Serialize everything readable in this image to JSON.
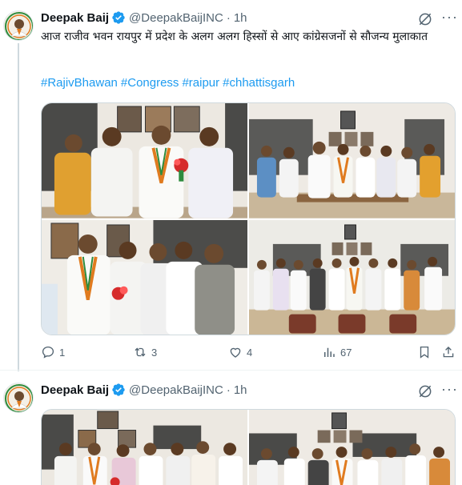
{
  "tweets": [
    {
      "author": {
        "name": "Deepak Baij",
        "handle": "@DeepakBaijINC",
        "time": "1h",
        "avatar_icon": "profile-photo"
      },
      "text": "आज राजीव भवन रायपुर में प्रदेश के अलग अलग हिस्सों से आए कांग्रेसजनों से सौजन्य मुलाकात",
      "hashtags": [
        "#RajivBhawan",
        "#Congress",
        "#raipur",
        "#chhattisgarh"
      ],
      "photos": [
        "group-welcome-bouquet-photo",
        "group-office-meeting-photo",
        "group-welcome-photo-2",
        "group-office-meeting-photo-2"
      ],
      "actions": {
        "replies": "1",
        "reposts": "3",
        "likes": "4",
        "views": "67"
      }
    },
    {
      "author": {
        "name": "Deepak Baij",
        "handle": "@DeepakBaijINC",
        "time": "1h",
        "avatar_icon": "profile-photo"
      },
      "photos": [
        "group-photo-3",
        "group-photo-4"
      ]
    }
  ],
  "colors": {
    "link": "#1d9bf0",
    "verified": "#1d9bf0",
    "muted": "#536471",
    "text": "#0f1419"
  }
}
